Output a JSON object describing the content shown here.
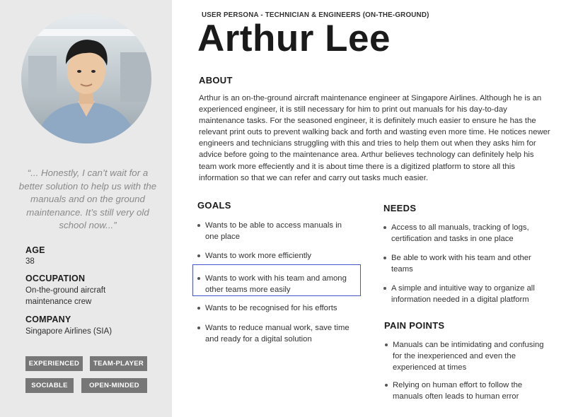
{
  "sidebar": {
    "quote": "“... Honestly, I can’t wait for a better solution to help us with the manuals and on the ground maintenance. It’s still very old school now...”",
    "age": {
      "label": "AGE",
      "value": "38"
    },
    "occupation": {
      "label": "OCCUPATION",
      "value": "On-the-ground aircraft maintenance crew"
    },
    "company": {
      "label": "COMPANY",
      "value": "Singapore Airlines (SIA)"
    },
    "tags": [
      "EXPERIENCED",
      "TEAM-PLAYER",
      "SOCIABLE",
      "OPEN-MINDED"
    ]
  },
  "header": {
    "eyebrow": "USER PERSONA - TECHNICIAN & ENGINEERS (ON-THE-GROUND)",
    "name": "Arthur Lee"
  },
  "about": {
    "title": "ABOUT",
    "text": "Arthur is an on-the-ground aircraft maintenance engineer at Singapore Airlines. Although he is an experienced engineer, it is still necessary for him to print out manuals for his day-to-day maintenance tasks. For the seasoned engineer, it is definitely much easier to ensure he has the relevant print outs to prevent walking back and forth and wasting even more time. He notices newer engineers and technicians struggling with this and tries to help them out when they asks him for advice before going to the maintenance area. Arthur believes technology can definitely help his team work more effeciently and it is about time there is a digitized platform to store all this information so that we can refer and carry out tasks much easier."
  },
  "goals": {
    "title": "GOALS",
    "items": [
      "Wants to be able to access manuals in one place",
      "Wants to work more efficiently",
      "Wants to work with his team and among other teams more easily",
      "Wants to be recognised for his efforts",
      "Wants to reduce manual work, save time and ready for a digital solution"
    ]
  },
  "needs": {
    "title": "NEEDS",
    "items": [
      "Access to all manuals, tracking of logs, certification and tasks in one place",
      "Be able to work with his team and other teams",
      "A simple and intuitive way to organize all information needed in a digital platform"
    ]
  },
  "pain_points": {
    "title": "PAIN POINTS",
    "items": [
      "Manuals can be intimidating and confusing for the inexperienced and even the experienced at times",
      "Relying on human effort to follow the manuals often leads to human error"
    ]
  },
  "colors": {
    "sidebar_bg": "#e9e9e9",
    "tag_bg": "#777777",
    "highlight_border": "#4a53d0"
  }
}
